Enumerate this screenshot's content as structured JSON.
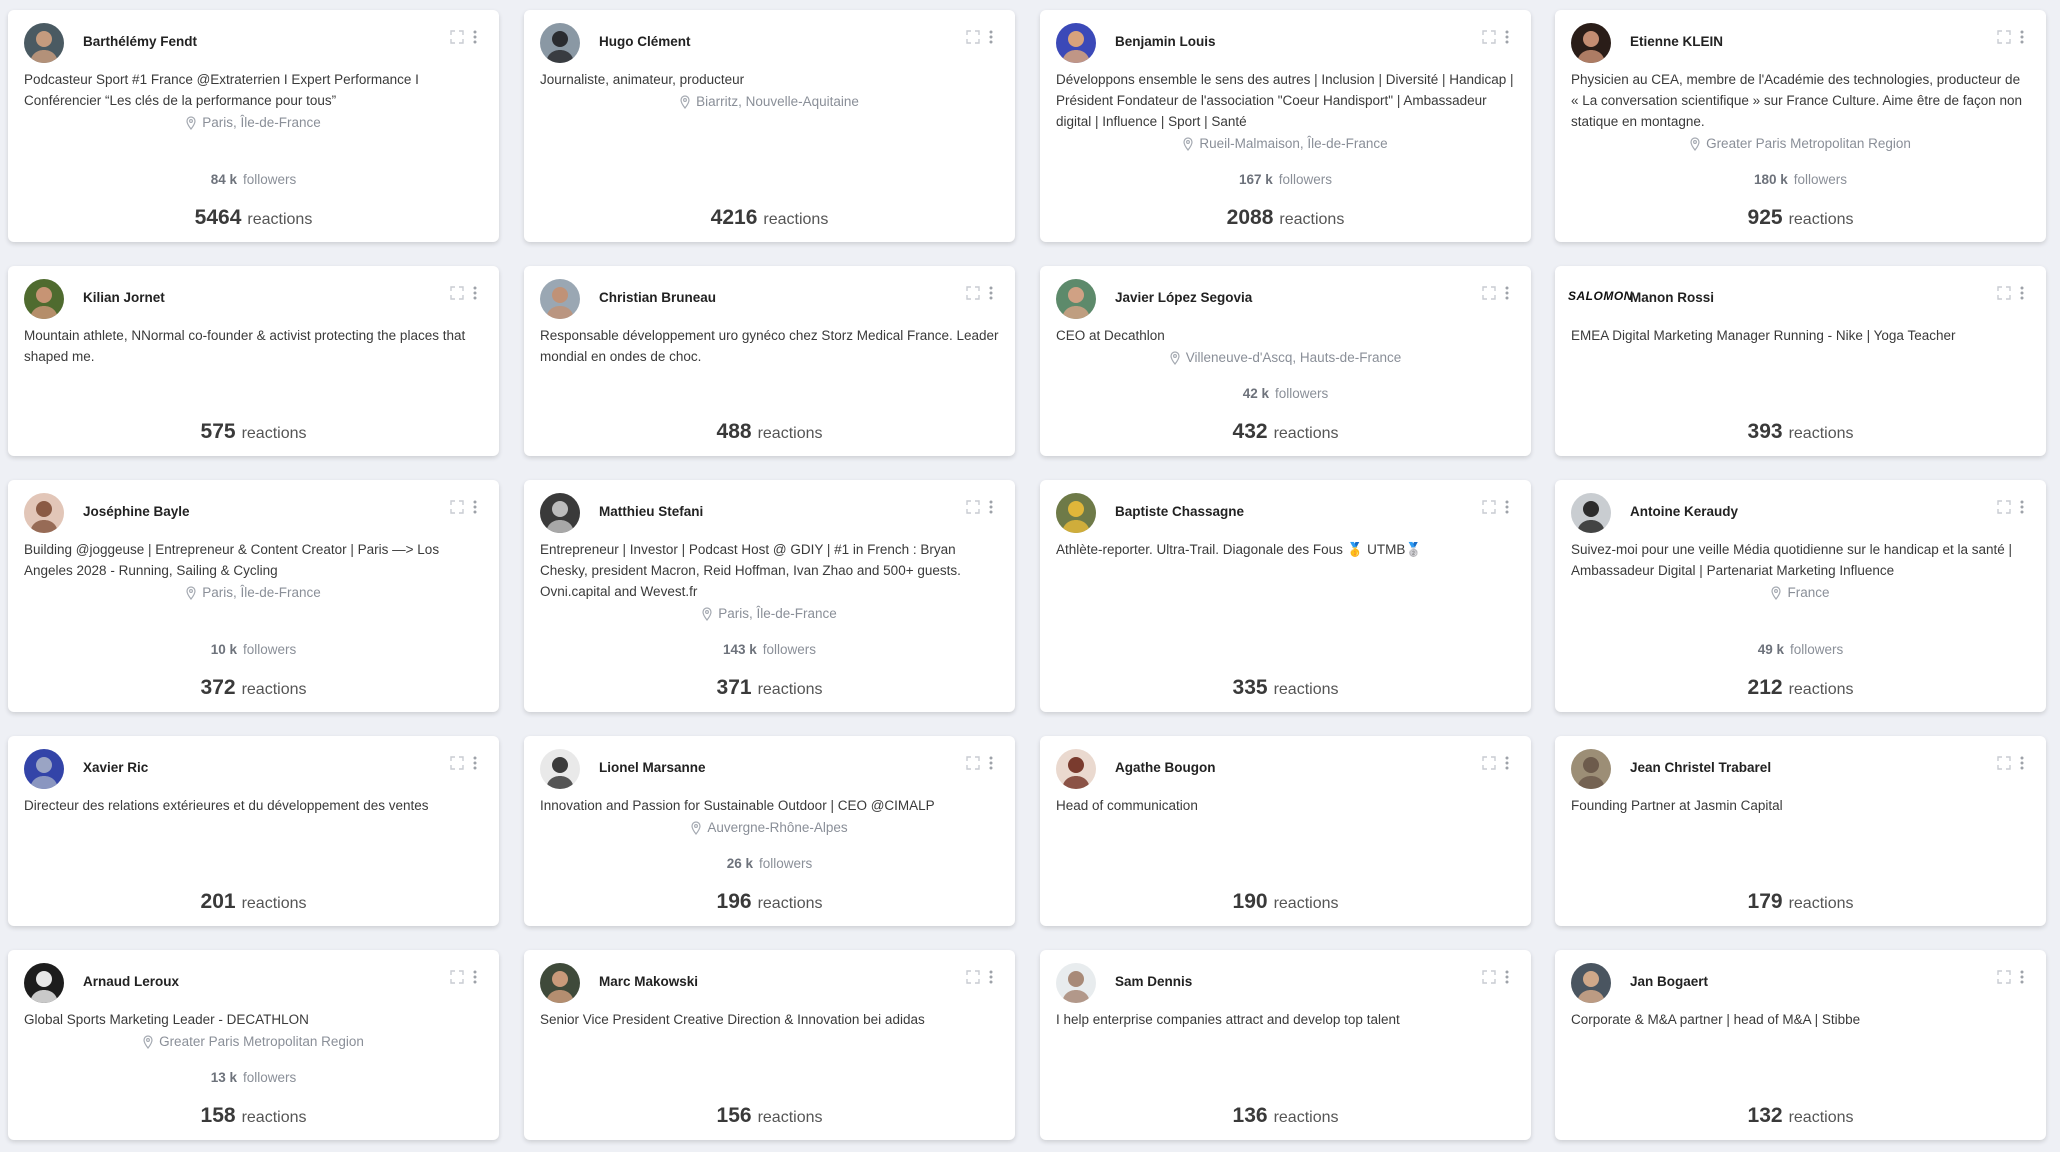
{
  "labels": {
    "followers": "followers",
    "reactions": "reactions"
  },
  "icons": {
    "card_actions": [
      "expand-icon",
      "more-vertical-icon"
    ],
    "location": "location-pin-icon"
  },
  "profiles": [
    {
      "name": "Barthélémy Fendt",
      "bio": "Podcasteur Sport #1 France @Extraterrien I Expert Performance I Conférencier “Les clés de la performance pour tous”",
      "location": "Paris, Île-de-France",
      "followers": "84 k",
      "reactions": "5464",
      "avatar": {
        "bg": "#4a5a62",
        "fg": "#c59b7e",
        "type": "photo"
      }
    },
    {
      "name": "Hugo Clément",
      "bio": "Journaliste, animateur, producteur",
      "location": "Biarritz, Nouvelle-Aquitaine",
      "followers": "",
      "reactions": "4216",
      "avatar": {
        "bg": "#8a98a4",
        "fg": "#2a2c30",
        "type": "photo"
      }
    },
    {
      "name": "Benjamin Louis",
      "bio": "Développons ensemble le sens des autres | Inclusion | Diversité | Handicap | Président Fondateur de l'association \"Coeur Handisport\" | Ambassadeur digital | Influence | Sport | Santé",
      "location": "Rueil-Malmaison, Île-de-France",
      "followers": "167 k",
      "reactions": "2088",
      "avatar": {
        "bg": "#3b49b8",
        "fg": "#d8a37c",
        "type": "photo"
      }
    },
    {
      "name": "Etienne KLEIN",
      "bio": "Physicien au CEA, membre de l'Académie des technologies, producteur de « La conversation scientifique » sur France Culture. Aime être de façon non statique en montagne.",
      "location": "Greater Paris Metropolitan Region",
      "followers": "180 k",
      "reactions": "925",
      "avatar": {
        "bg": "#2a1d18",
        "fg": "#c48d72",
        "type": "photo"
      }
    },
    {
      "name": "Kilian Jornet",
      "bio": "Mountain athlete, NNormal co-founder & activist protecting the places that shaped me.",
      "location": "",
      "followers": "",
      "reactions": "575",
      "avatar": {
        "bg": "#4f6b2f",
        "fg": "#c79474",
        "type": "photo"
      }
    },
    {
      "name": "Christian Bruneau",
      "bio": "Responsable développement uro gynéco chez Storz Medical France. Leader mondial en ondes de choc.",
      "location": "",
      "followers": "",
      "reactions": "488",
      "avatar": {
        "bg": "#9aa7b3",
        "fg": "#c09277",
        "type": "photo"
      }
    },
    {
      "name": "Javier López Segovia",
      "bio": "CEO at Decathlon",
      "location": "Villeneuve-d'Ascq, Hauts-de-France",
      "followers": "42 k",
      "reactions": "432",
      "avatar": {
        "bg": "#5d8a6b",
        "fg": "#d0a184",
        "type": "photo"
      }
    },
    {
      "name": "Manon Rossi",
      "bio": "EMEA Digital Marketing Manager Running - Nike | Yoga Teacher",
      "location": "",
      "followers": "",
      "reactions": "393",
      "logo": "SALOMON"
    },
    {
      "name": "Joséphine Bayle",
      "bio": "Building @joggeuse | Entrepreneur & Content Creator | Paris —> Los Angeles 2028 - Running, Sailing & Cycling",
      "location": "Paris, Île-de-France",
      "followers": "10 k",
      "reactions": "372",
      "avatar": {
        "bg": "#e2c6b8",
        "fg": "#8a5a44",
        "type": "photo"
      }
    },
    {
      "name": "Matthieu Stefani",
      "bio": "Entrepreneur | Investor | Podcast Host @ GDIY | #1 in French : Bryan Chesky, president Macron, Reid Hoffman, Ivan Zhao and 500+ guests. Ovni.capital and Wevest.fr",
      "location": "Paris, Île-de-France",
      "followers": "143 k",
      "reactions": "371",
      "avatar": {
        "bg": "#3a3a3a",
        "fg": "#bcbcbc",
        "type": "photo"
      }
    },
    {
      "name": "Baptiste Chassagne",
      "bio": "Athlète-reporter. Ultra-Trail. Diagonale des Fous 🥇 UTMB🥈",
      "location": "",
      "followers": "",
      "reactions": "335",
      "avatar": {
        "bg": "#6e7a48",
        "fg": "#e0b63a",
        "type": "photo"
      }
    },
    {
      "name": "Antoine Keraudy",
      "bio": "Suivez-moi pour une veille Média quotidienne sur le handicap et la santé | Ambassadeur Digital | Partenariat Marketing Influence",
      "location": "France",
      "followers": "49 k",
      "reactions": "212",
      "avatar": {
        "bg": "#c9cdd1",
        "fg": "#2c2c2c",
        "type": "photo"
      }
    },
    {
      "name": "Xavier Ric",
      "bio": "Directeur des relations extérieures et du développement des ventes",
      "location": "",
      "followers": "",
      "reactions": "201",
      "avatar": {
        "bg": "#3344a8",
        "fg": "#9aa4c4",
        "type": "photo"
      }
    },
    {
      "name": "Lionel Marsanne",
      "bio": "Innovation and Passion for Sustainable Outdoor | CEO @CIMALP",
      "location": "Auvergne-Rhône-Alpes",
      "followers": "26 k",
      "reactions": "196",
      "avatar": {
        "bg": "#e9e9e9",
        "fg": "#3b3b3b",
        "type": "photo"
      }
    },
    {
      "name": "Agathe Bougon",
      "bio": "Head of communication",
      "location": "",
      "followers": "",
      "reactions": "190",
      "avatar": {
        "bg": "#ead9cf",
        "fg": "#7a3b2e",
        "type": "photo"
      }
    },
    {
      "name": "Jean Christel Trabarel",
      "bio": "Founding Partner at Jasmin Capital",
      "location": "",
      "followers": "",
      "reactions": "179",
      "avatar": {
        "bg": "#9c8e76",
        "fg": "#6d5b4c",
        "type": "photo"
      }
    },
    {
      "name": "Arnaud Leroux",
      "bio": "Global Sports Marketing Leader - DECATHLON",
      "location": "Greater Paris Metropolitan Region",
      "followers": "13 k",
      "reactions": "158",
      "avatar": {
        "bg": "#1d1d1d",
        "fg": "#e8e8e8",
        "type": "photo"
      }
    },
    {
      "name": "Marc Makowski",
      "bio": "Senior Vice President Creative Direction & Innovation bei adidas",
      "location": "",
      "followers": "",
      "reactions": "156",
      "avatar": {
        "bg": "#3f4a3a",
        "fg": "#c99a7a",
        "type": "photo"
      }
    },
    {
      "name": "Sam Dennis",
      "bio": "I help enterprise companies attract and develop top talent",
      "location": "",
      "followers": "",
      "reactions": "136",
      "avatar": {
        "bg": "#e8ecee",
        "fg": "#a88a78",
        "type": "photo"
      }
    },
    {
      "name": "Jan Bogaert",
      "bio": "Corporate & M&A partner | head of M&A | Stibbe",
      "location": "",
      "followers": "",
      "reactions": "132",
      "avatar": {
        "bg": "#4a5560",
        "fg": "#d0a889",
        "type": "photo"
      }
    }
  ]
}
